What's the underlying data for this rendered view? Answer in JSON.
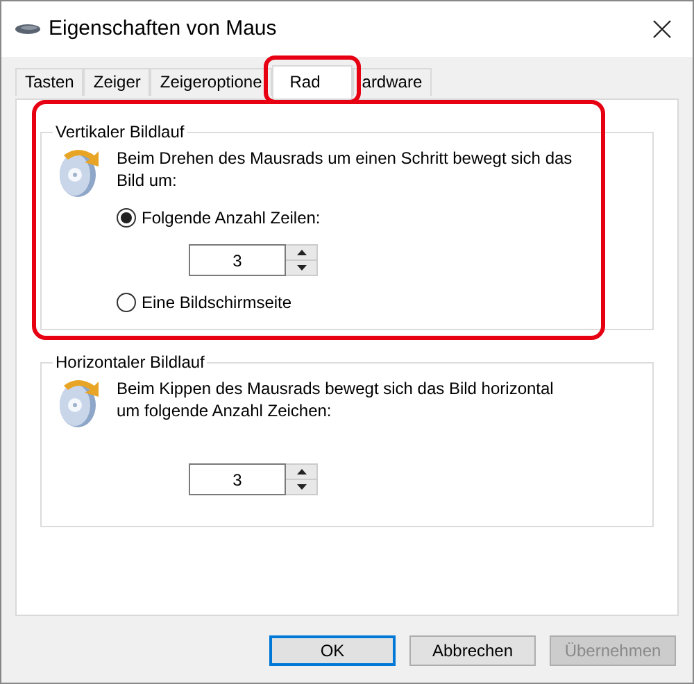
{
  "window": {
    "title": "Eigenschaften von Maus"
  },
  "tabs": [
    {
      "label": "Tasten",
      "selected": false,
      "highlighted": false
    },
    {
      "label": "Zeiger",
      "selected": false,
      "highlighted": false
    },
    {
      "label": "Zeigeroptione",
      "selected": false,
      "highlighted": false
    },
    {
      "label": "Rad",
      "selected": true,
      "highlighted": true
    },
    {
      "label": "ardware",
      "selected": false,
      "highlighted": false
    }
  ],
  "groups": [
    {
      "title": "Vertikaler Bildlauf",
      "highlighted": true,
      "description": "Beim Drehen des Mausrads um einen Schritt bewegt sich das Bild um:",
      "options": [
        {
          "kind": "radio",
          "label": "Folgende Anzahl Zeilen:",
          "selected": true
        },
        {
          "kind": "spinner",
          "value": "3"
        },
        {
          "kind": "radio",
          "label": "Eine Bildschirmseite",
          "selected": false
        }
      ]
    },
    {
      "title": "Horizontaler Bildlauf",
      "highlighted": false,
      "description": "Beim Kippen des Mausrads bewegt sich das Bild horizontal um folgende Anzahl Zeichen:",
      "options": [
        {
          "kind": "spinner",
          "value": "3"
        }
      ]
    }
  ],
  "buttons": [
    {
      "label": "OK",
      "default": true,
      "disabled": false
    },
    {
      "label": "Abbrechen",
      "default": false,
      "disabled": false
    },
    {
      "label": "Übernehmen",
      "default": false,
      "disabled": true
    }
  ]
}
